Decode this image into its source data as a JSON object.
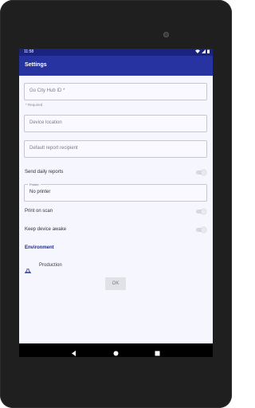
{
  "status_bar": {
    "time": "11:58",
    "wifi_icon": "wifi-icon",
    "signal_icon": "signal-icon",
    "battery_icon": "battery-icon"
  },
  "app_bar": {
    "title": "Settings"
  },
  "fields": {
    "go_city_hub_id": {
      "placeholder": "Go City Hub ID *",
      "helper": "* Required"
    },
    "device_location": {
      "placeholder": "Device location"
    },
    "default_report_recipient": {
      "placeholder": "Default report recipient"
    }
  },
  "switches": {
    "send_daily_reports": {
      "label": "Send daily reports",
      "on": false
    },
    "print_on_scan": {
      "label": "Print on scan",
      "on": false
    },
    "keep_device_awake": {
      "label": "Keep device awake",
      "on": false
    }
  },
  "printer": {
    "label": "Printer",
    "value": "No printer"
  },
  "environment": {
    "title": "Environment",
    "selected": "Production",
    "icon": "flask-icon"
  },
  "actions": {
    "ok_label": "OK"
  },
  "colors": {
    "primary": "#2733a0",
    "status_bar": "#1a237e",
    "background": "#f6f6ff"
  },
  "navigation": {
    "back_icon": "back-triangle-icon",
    "home_icon": "home-circle-icon",
    "recents_icon": "recents-square-icon"
  }
}
